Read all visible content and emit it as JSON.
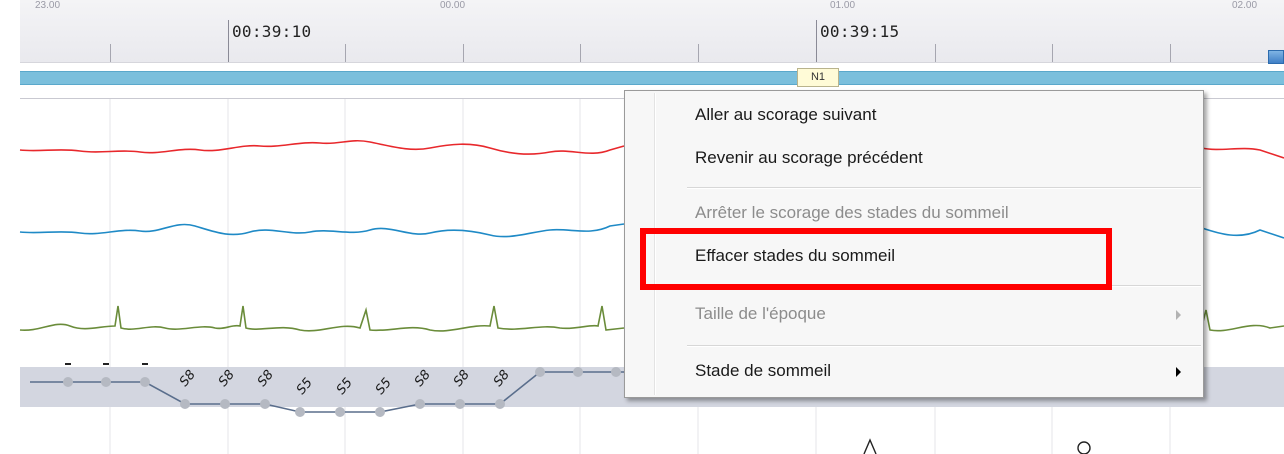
{
  "timeline": {
    "top_ticks": [
      "23.00",
      "00.00",
      "01.00",
      "02.00"
    ],
    "time_labels": [
      "00:39:10",
      "00:39:15"
    ]
  },
  "stage_label": "N1",
  "hypnogram": {
    "scores": [
      "S8",
      "S8",
      "S8",
      "S5",
      "S5",
      "S5",
      "S8",
      "S8",
      "S8"
    ]
  },
  "context_menu": {
    "items": [
      {
        "label": "Aller au scorage suivant",
        "enabled": true
      },
      {
        "label": "Revenir au scorage précédent",
        "enabled": true
      },
      {
        "label": "Arrêter le scorage des stades du sommeil",
        "enabled": false
      },
      {
        "label": "Effacer stades du sommeil",
        "enabled": true,
        "highlighted": true
      },
      {
        "label": "Taille de l'époque",
        "enabled": false,
        "submenu": true
      },
      {
        "label": "Stade de sommeil",
        "enabled": true,
        "submenu": true
      }
    ]
  },
  "colors": {
    "signal_red": "#e8282c",
    "signal_blue": "#1f8ac6",
    "signal_green": "#6a8c3a",
    "stage_bar": "#7bbfdc",
    "highlight": "#ff0000",
    "hypnogram_band": "#d3d6e0"
  }
}
